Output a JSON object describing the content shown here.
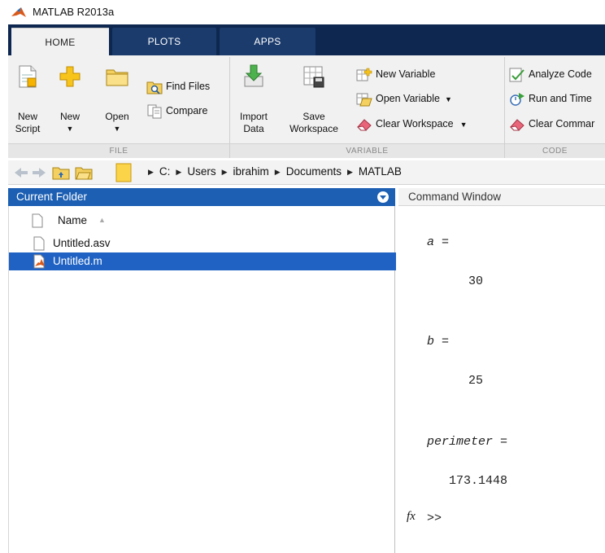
{
  "window": {
    "title": "MATLAB R2013a"
  },
  "tabs": [
    {
      "label": "HOME",
      "active": true
    },
    {
      "label": "PLOTS",
      "active": false
    },
    {
      "label": "APPS",
      "active": false
    }
  ],
  "ribbon": {
    "file": {
      "section_label": "FILE",
      "new_script": {
        "line1": "New",
        "line2": "Script"
      },
      "new": {
        "label": "New"
      },
      "open": {
        "label": "Open"
      },
      "find_files": "Find Files",
      "compare": "Compare"
    },
    "variable": {
      "section_label": "VARIABLE",
      "import_data": {
        "line1": "Import",
        "line2": "Data"
      },
      "save_workspace": {
        "line1": "Save",
        "line2": "Workspace"
      },
      "new_variable": "New Variable",
      "open_variable": "Open Variable",
      "clear_workspace": "Clear Workspace"
    },
    "code": {
      "section_label": "CODE",
      "analyze_code": "Analyze Code",
      "run_and_time": "Run and Time",
      "clear_commands": "Clear Commar"
    }
  },
  "address_bar": {
    "path": [
      "C:",
      "Users",
      "ibrahim",
      "Documents",
      "MATLAB"
    ]
  },
  "current_folder": {
    "title": "Current Folder",
    "column_header": "Name",
    "files": [
      {
        "name": "Untitled.asv",
        "selected": false,
        "type": "asv"
      },
      {
        "name": "Untitled.m",
        "selected": true,
        "type": "m"
      }
    ]
  },
  "command_window": {
    "title": "Command Window",
    "outputs": [
      {
        "var": "a =",
        "value": "30"
      },
      {
        "var": "b =",
        "value": "25"
      },
      {
        "var": "perimeter =",
        "value": "173.1448"
      }
    ],
    "fx_label": "fx",
    "prompt": ">>"
  },
  "colors": {
    "tab_strip": "#0d2750",
    "panel_header": "#1c5fb3",
    "selection": "#1f62c3",
    "ribbon_bg": "#f1f1f1"
  }
}
